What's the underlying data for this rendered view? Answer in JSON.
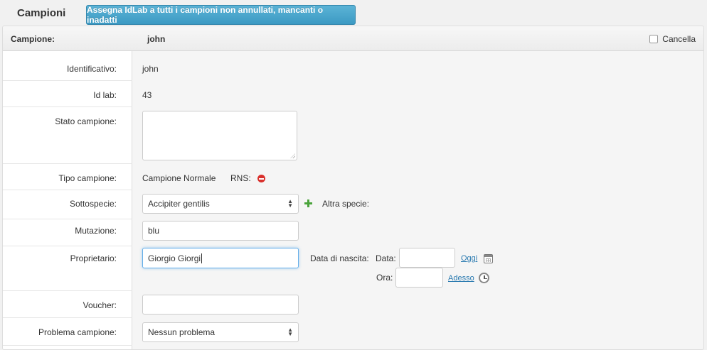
{
  "page": {
    "title": "Campioni",
    "assign_button": "Assegna IdLab a tutti i campioni non annullati, mancanti o inadatti"
  },
  "header": {
    "label": "Campione:",
    "value": "john",
    "cancel_label": "Cancella"
  },
  "fields": {
    "identificativo": {
      "label": "Identificativo:",
      "value": "john"
    },
    "id_lab": {
      "label": "Id lab:",
      "value": "43"
    },
    "stato": {
      "label": "Stato campione:",
      "value": ""
    },
    "tipo": {
      "label": "Tipo campione:",
      "value": "Campione Normale",
      "rns_label": "RNS:"
    },
    "sottospecie": {
      "label": "Sottospecie:",
      "value": "Accipiter gentilis",
      "altra_label": "Altra specie:"
    },
    "mutazione": {
      "label": "Mutazione:",
      "value": "blu"
    },
    "proprietario": {
      "label": "Proprietario:",
      "value": "Giorgio Giorgi"
    },
    "nascita": {
      "label": "Data di nascita:",
      "data_label": "Data:",
      "data_value": "",
      "oggi_link": "Oggi",
      "ora_label": "Ora:",
      "ora_value": "",
      "adesso_link": "Adesso"
    },
    "voucher": {
      "label": "Voucher:",
      "value": ""
    },
    "problema": {
      "label": "Problema campione:",
      "value": "Nessun problema"
    }
  },
  "icons": {
    "rns": "minus-circle-icon",
    "add_species": "plus-icon",
    "calendar": "calendar-icon",
    "clock": "clock-icon"
  },
  "colors": {
    "primary_button": "#4aa8d0",
    "link": "#2a7ab0",
    "focus": "#66afe9",
    "danger": "#d9302c",
    "success": "#4aa33b"
  }
}
